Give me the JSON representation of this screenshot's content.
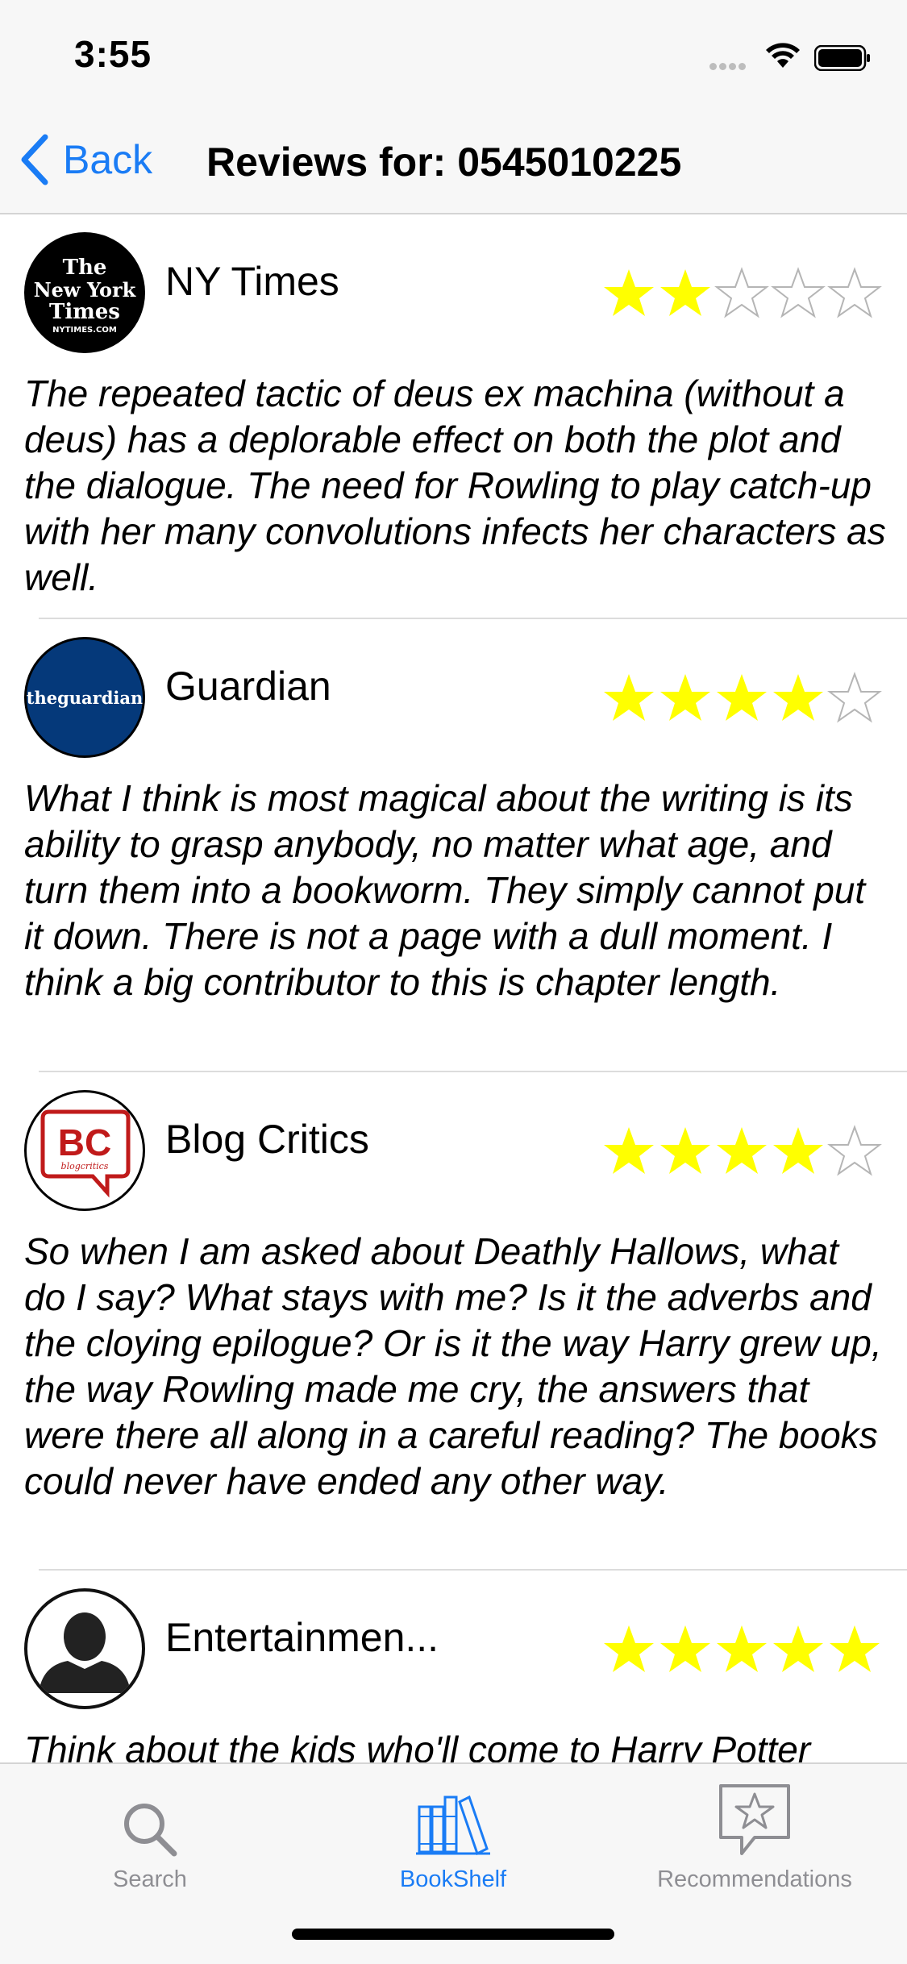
{
  "status_bar": {
    "time": "3:55"
  },
  "nav": {
    "back_label": "Back",
    "title": "Reviews for: 0545010225"
  },
  "reviews": [
    {
      "source": "NY Times",
      "logo_text": [
        "The",
        "New York",
        "Times",
        "NYTIMES.COM"
      ],
      "rating": 2,
      "text": "The repeated tactic of deus ex machina (without a deus) has a deplorable effect on both the plot and the dialogue. The need for Rowling to play catch-up with her many convolutions infects her characters as well."
    },
    {
      "source": "Guardian",
      "logo_text": [
        "theguardian"
      ],
      "rating": 4,
      "text": "What I think is most magical about the writing is its ability to grasp anybody, no matter what age, and turn them into a bookworm. They simply cannot put it down. There is not a page with a dull moment. I think a big contributor to this is chapter length."
    },
    {
      "source": "Blog Critics",
      "logo_text": [
        "BC",
        "blogcritics"
      ],
      "rating": 4,
      "text": "So when I am asked about Deathly Hallows, what do I say? What stays with me? Is it the adverbs and the cloying epilogue? Or is it the way Harry grew up, the way Rowling made me cry, the answers that were there all along in a careful reading? The books could never have ended any other way."
    },
    {
      "source": "Entertainmen...",
      "logo_text": [],
      "rating": 5,
      "text": "Think about the kids who'll come to Harry Potter"
    }
  ],
  "tabs": [
    {
      "label": "Search",
      "icon": "search-icon",
      "active": false
    },
    {
      "label": "BookShelf",
      "icon": "bookshelf-icon",
      "active": true
    },
    {
      "label": "Recommendations",
      "icon": "recommendations-icon",
      "active": false
    }
  ],
  "colors": {
    "accent": "#1a7cf5",
    "star_filled": "#ffff00",
    "tab_inactive": "#8e8e93"
  }
}
